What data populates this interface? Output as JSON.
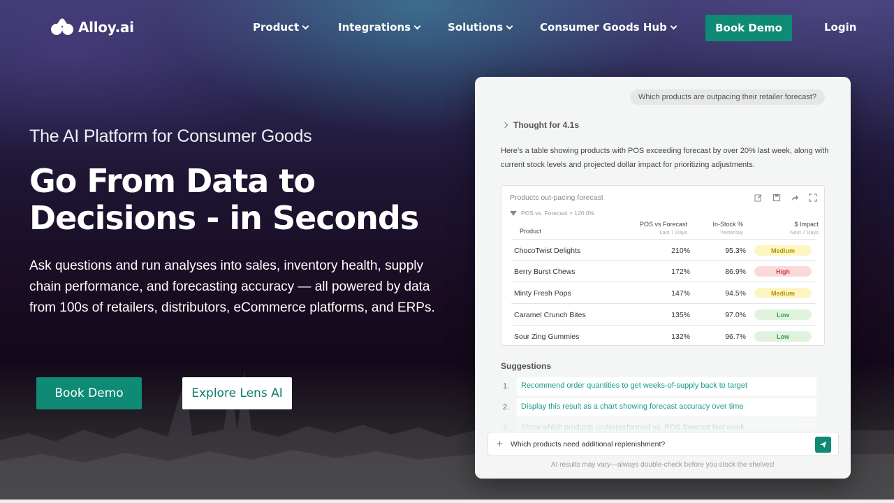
{
  "nav": {
    "logo_text": "Alloy.ai",
    "items": [
      {
        "label": "Product"
      },
      {
        "label": "Integrations"
      },
      {
        "label": "Solutions"
      },
      {
        "label": "Consumer Goods Hub"
      }
    ],
    "demo_label": "Book Demo",
    "login_label": "Login"
  },
  "hero": {
    "eyebrow": "The AI Platform for Consumer Goods",
    "headline": "Go From Data to Decisions - in Seconds",
    "subtext": "Ask questions and run analyses into sales, inventory health, supply chain performance, and forecasting accuracy — all powered by data from 100s of retailers, distributors, eCommerce platforms, and ERPs.",
    "primary_cta": "Book Demo",
    "secondary_cta": "Explore Lens AI"
  },
  "panel": {
    "user_question": "Which products are outpacing their retailer forecast?",
    "thought": "Thought for 4.1s",
    "answer": "Here’s a table showing products with POS exceeding forecast by over 20% last week, along with current stock levels and projected dollar impact for prioritizing adjustments.",
    "table": {
      "title": "Products out-pacing forecast",
      "filter": "POS vs. Forecast > 120.0%",
      "headers": {
        "product": "Product",
        "pos": "POS vs Forecast",
        "pos_sub": "Last 7 Days",
        "stock": "In-Stock %",
        "stock_sub": "Yesterday",
        "impact": "$ Impact",
        "impact_sub": "Next 7 Days"
      },
      "rows": [
        {
          "product": "ChocoTwist Delights",
          "pos": "210%",
          "stock": "95.3%",
          "impact": "Medium"
        },
        {
          "product": "Berry Burst Chews",
          "pos": "172%",
          "stock": "86.9%",
          "impact": "High"
        },
        {
          "product": "Minty Fresh Pops",
          "pos": "147%",
          "stock": "94.5%",
          "impact": "Medium"
        },
        {
          "product": "Caramel Crunch Bites",
          "pos": "135%",
          "stock": "97.0%",
          "impact": "Low"
        },
        {
          "product": "Sour Zing Gummies",
          "pos": "132%",
          "stock": "96.7%",
          "impact": "Low"
        }
      ]
    },
    "suggestions_title": "Suggestions",
    "suggestions": [
      {
        "num": "1.",
        "text": "Recommend order quantities to get weeks-of-supply back to target"
      },
      {
        "num": "2.",
        "text": "Display this result as a chart showing forecast accuracy over time"
      },
      {
        "num": "3.",
        "text": "Show which products underperformed vs. POS forecast last week"
      }
    ],
    "chat_input": "Which products need additional replenishment?",
    "disclaimer": "AI results may vary—always double-check before you stock the shelves!"
  },
  "colors": {
    "accent": "#0f8a75",
    "impact_medium": "#fdf6c3",
    "impact_high": "#fbd9d9",
    "impact_low": "#dff3df"
  }
}
